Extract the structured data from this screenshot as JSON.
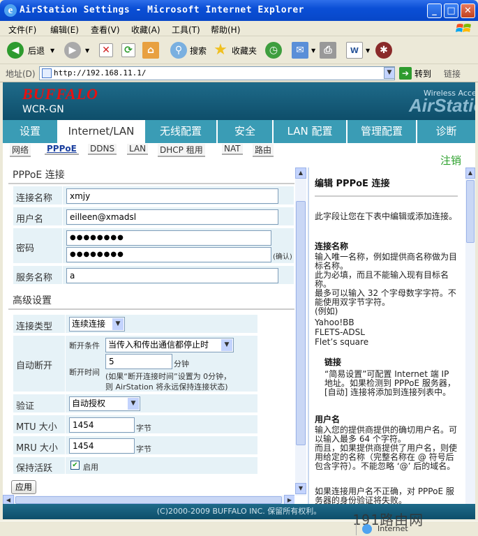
{
  "window": {
    "title": "AirStation Settings - Microsoft Internet Explorer",
    "ie_logo": "ie-logo-icon",
    "minimize": "_",
    "maximize": "□",
    "close": "✕"
  },
  "menu": [
    "文件(F)",
    "编辑(E)",
    "查看(V)",
    "收藏(A)",
    "工具(T)",
    "帮助(H)"
  ],
  "toolbar": {
    "back": "后退",
    "search": "搜索",
    "favorites": "收藏夹"
  },
  "address": {
    "label": "地址(D)",
    "url": "http://192.168.11.1/",
    "go": "转到",
    "links": "链接"
  },
  "header": {
    "brand": "BUFFALO",
    "model": "WCR-GN",
    "wireless": "Wireless Access",
    "airstation": "AirStation"
  },
  "tabs": [
    "设置",
    "Internet/LAN",
    "无线配置",
    "安全",
    "LAN 配置",
    "管理配置",
    "诊断"
  ],
  "subtabs": [
    "网络",
    "PPPoE",
    "DDNS",
    "LAN",
    "DHCP 租用",
    "NAT",
    "路由"
  ],
  "logout": "注销",
  "form": {
    "section_title": "PPPoE 连接",
    "conn_name_label": "连接名称",
    "conn_name": "xmjy",
    "username_label": "用户名",
    "username": "eilleen@xmadsl",
    "password_label": "密码",
    "password": "●●●●●●●●",
    "password_confirm": "●●●●●●●●",
    "confirm_hint": "(确认)",
    "service_label": "服务名称",
    "service": "a",
    "adv_title": "高级设置",
    "conn_type_label": "连接类型",
    "conn_type": "连续连接",
    "auto_disc_label": "自动断开",
    "disc_cond_label": "断开条件",
    "disc_cond": "当传入和传出通信都停止时",
    "disc_time_label": "断开时间",
    "disc_time": "5",
    "minutes": "分钟",
    "disc_note1": "(如果“断开连接时间”设置为 0分钟，",
    "disc_note2": "则 AirStation 将永远保持连接状态)",
    "auth_label": "验证",
    "auth": "自动授权",
    "mtu_label": "MTU 大小",
    "mtu": "1454",
    "mtu_unit": "字节",
    "mru_label": "MRU 大小",
    "mru": "1454",
    "mru_unit": "字节",
    "keepalive_label": "保持活跃",
    "keepalive": "启用",
    "apply": "应用"
  },
  "help": {
    "title": "编辑 PPPoE 连接",
    "intro": "此字段让您在下表中编辑或添加连接。",
    "name_h": "连接名称",
    "name_t1": "输入唯一名称，例如提供商名称做为目标名称。",
    "name_t2": "此为必填，而且不能输入现有目标名称。",
    "name_t3": "最多可以输入 32 个字母数字字符。不能使用双字节字符。",
    "name_t4": "(例如)",
    "ex1": "Yahoo!BB",
    "ex2": "FLETS-ADSL",
    "ex3": "Flet’s square",
    "link_h": "链接",
    "link_t": "“简易设置”可配置 Internet 端 IP 地址。如果检测到 PPPoE 服务器，[自动] 连接将添加到连接列表中。",
    "user_h": "用户名",
    "user_t1": "输入您的提供商提供的确切用户名。可以输入最多 64 个字符。",
    "user_t2": "而且，如果提供商提供了用户名，则使用给定的名称（完整名称在 @ 符号后包含字符）。不能忽略 ‘@’ 后的域名。",
    "user_t3": "如果连接用户名不正确，对 PPPoE 服务器的身份验证将失败。"
  },
  "footer": {
    "copyright": "(C)2000-2009 BUFFALO INC. 保留所有权利。",
    "zone": "Internet",
    "watermark": "191路由网"
  }
}
